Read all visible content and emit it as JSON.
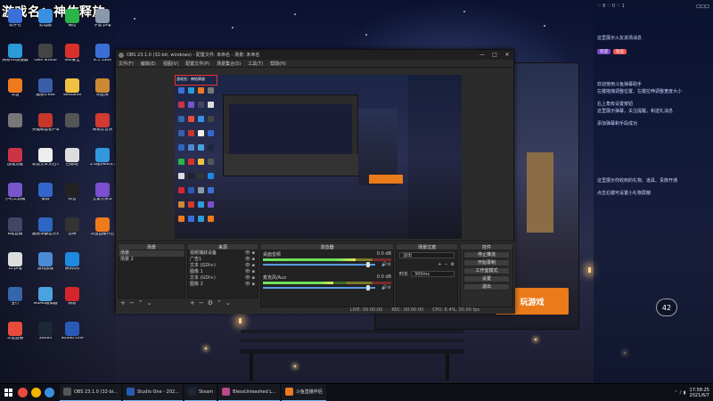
{
  "stream": {
    "title": "游戏名：神佑释放"
  },
  "desktop_icons": [
    {
      "label": "软件包",
      "color": "#3a6fd8"
    },
    {
      "label": "网易UU加速器",
      "color": "#2a9bd8"
    },
    {
      "label": "斗鱼",
      "color": "#ef7a1e"
    },
    {
      "label": "",
      "color": "#777777"
    },
    {
      "label": "战魂觉醒",
      "color": "#cc3344"
    },
    {
      "label": "小礼工具箱",
      "color": "#7755cc"
    },
    {
      "label": "B站直播",
      "color": "#444466"
    },
    {
      "label": "1z.png",
      "color": "#dddddd"
    },
    {
      "label": "五行",
      "color": "#3366aa"
    },
    {
      "label": "斗鱼直播",
      "color": "#e84c3d"
    },
    {
      "label": "此电脑",
      "color": "#3a8fe0"
    },
    {
      "label": "OBS Studio",
      "color": "#444444"
    },
    {
      "label": "魔兽4.exe",
      "color": "#3b5ea8"
    },
    {
      "label": "英雄联盟客户端",
      "color": "#c7362b"
    },
    {
      "label": "新建文本文档.txt",
      "color": "#eeeeee"
    },
    {
      "label": "录屏",
      "color": "#3366cc"
    },
    {
      "label": "魔兽争霸官方对战平台",
      "color": "#2e66c4"
    },
    {
      "label": "游戏加速",
      "color": "#4d8ad6"
    },
    {
      "label": "MuMu模拟器",
      "color": "#4aa3df"
    },
    {
      "label": "Steam",
      "color": "#1b2838"
    },
    {
      "label": "微信",
      "color": "#2ab348"
    },
    {
      "label": "360安全",
      "color": "#d9312a"
    },
    {
      "label": "WeGame",
      "color": "#f0c040"
    },
    {
      "label": "",
      "color": "#555555"
    },
    {
      "label": "回收站",
      "color": "#dddddd"
    },
    {
      "label": "抖音",
      "color": "#222222"
    },
    {
      "label": "剪映",
      "color": "#333333"
    },
    {
      "label": "腾讯QQ",
      "color": "#1e8ae0"
    },
    {
      "label": "网易",
      "color": "#d6252c"
    },
    {
      "label": "Studio One",
      "color": "#2a5ab8"
    },
    {
      "label": "宁夏.png",
      "color": "#8899aa"
    },
    {
      "label": "8.5 5304",
      "color": "#3a6fd8"
    },
    {
      "label": "明星库",
      "color": "#cc8833"
    },
    {
      "label": "网易云音乐",
      "color": "#d33a31"
    },
    {
      "label": "2.0版(Music)",
      "color": "#3399dd"
    },
    {
      "label": "元素大乐斗",
      "color": "#7a4fd0"
    },
    {
      "label": "斗鱼直播伴侣",
      "color": "#ef7a1e"
    }
  ],
  "obs": {
    "title": "OBS 23.1.0 (32-bit, windows) - 配置文件: 未命名 - 场景: 未命名",
    "menu": [
      "文件(F)",
      "编辑(E)",
      "视图(V)",
      "配置文件(P)",
      "场景集合(S)",
      "工具(T)",
      "帮助(H)"
    ],
    "window_controls": [
      "—",
      "□",
      "✕"
    ],
    "preview_label": "游戏名：神佑释放",
    "docks": {
      "scenes_title": "场景",
      "scenes": [
        "场景",
        "场景 2"
      ],
      "sources_title": "来源",
      "sources": [
        "视频捕获设备",
        "广告1",
        "文本 (GDI+)",
        "图像 1",
        "文本 (GDI+)",
        "图像 2"
      ],
      "mixer_title": "混音器",
      "mixer": [
        {
          "name": "桌面音频",
          "db": "0.0 dB",
          "level": 0.72,
          "volume": 0.96
        },
        {
          "name": "麦克风/Aux",
          "db": "0.0 dB",
          "level": 0.55,
          "volume": 0.96
        }
      ],
      "transitions_title": "场景过渡",
      "transition_type": "淡出",
      "duration_label": "时长",
      "duration_value": "300ms",
      "controls_title": "控件",
      "controls": [
        "停止推流",
        "开始录制",
        "工作室模式",
        "设置",
        "退出"
      ]
    },
    "status": {
      "live": "LIVE: 00:00:00",
      "rec": "REC: 00:00:00",
      "cpu": "CPU: 6.4%, 30.00 fps"
    }
  },
  "game": {
    "button": "玩游戏",
    "bg_text": "3666"
  },
  "chat": {
    "header_left": "♡ 8 ♡ 0 ♡ 1",
    "header_right": "口口口",
    "badge1": "欢迎",
    "badge2": "粉丝",
    "lines": [
      "这里展示火友进场消息",
      "欢迎使用斗鱼弹幕助手",
      "左键拖拽调整位置、左键拉伸调整宽度大小",
      "右上角有设置按钮",
      "这里展示弹幕，关注提醒，和送礼消息",
      "添加弹幕和手段成功",
      "这里展示你收到的礼物、道具、贵族开通",
      "点击右键可设置小礼物屏蔽"
    ],
    "viewer_count": "42"
  },
  "taskbar": {
    "tasks": [
      {
        "label": "OBS 23.1.0 (32-bi...",
        "color": "#555555"
      },
      {
        "label": "Studio One - 202...",
        "color": "#2a5ab8"
      },
      {
        "label": "Steam",
        "color": "#1b2838"
      },
      {
        "label": "BlessUnleashed L...",
        "color": "#b84a8a"
      },
      {
        "label": "斗鱼直播伴侣",
        "color": "#ef7a1e"
      }
    ],
    "time": "17:58:25",
    "date": "2021/6/7"
  }
}
